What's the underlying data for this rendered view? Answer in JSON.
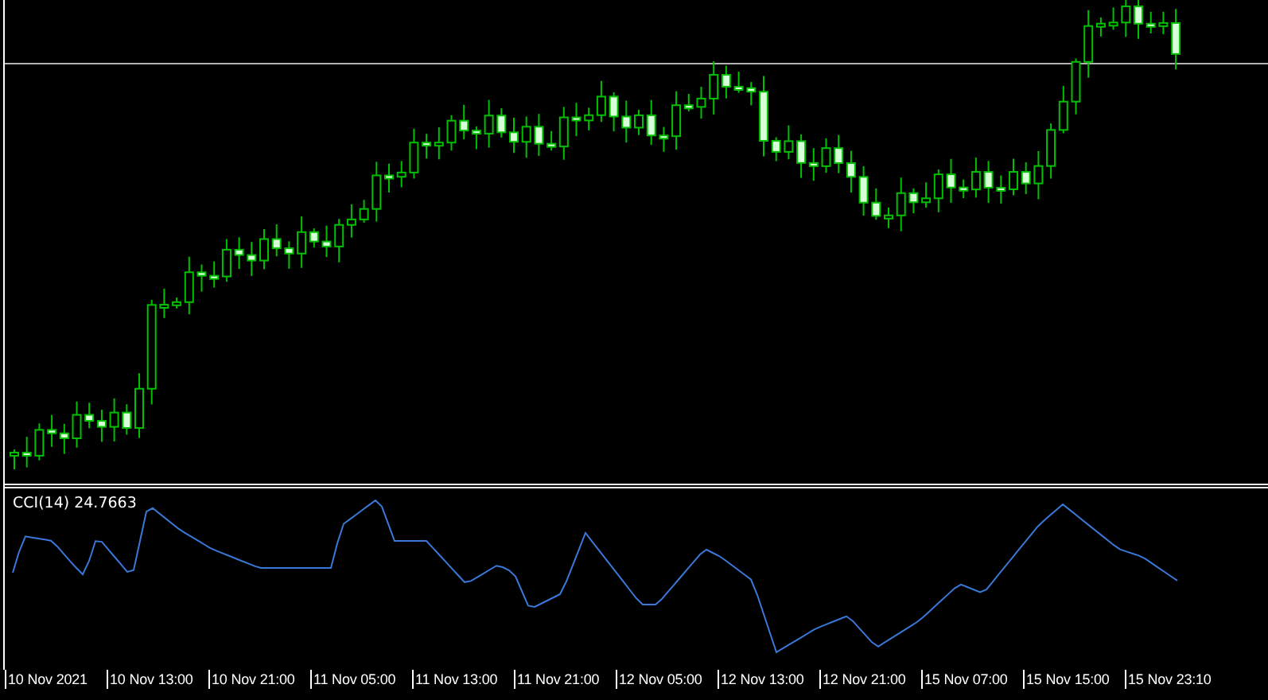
{
  "indicator": {
    "label": "CCI(14) 24.7663"
  },
  "time_axis": {
    "labels": [
      "10 Nov 2021",
      "10 Nov 13:00",
      "10 Nov 21:00",
      "11 Nov 05:00",
      "11 Nov 13:00",
      "11 Nov 21:00",
      "12 Nov 05:00",
      "12 Nov 13:00",
      "12 Nov 21:00",
      "15 Nov 07:00",
      "15 Nov 15:00",
      "15 Nov 23:10"
    ]
  }
}
